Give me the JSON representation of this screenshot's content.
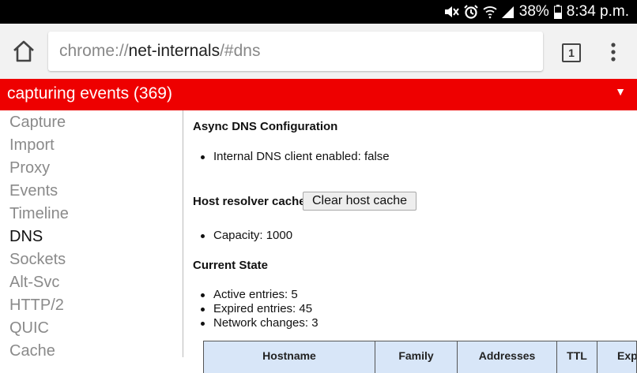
{
  "status_bar": {
    "battery_percent": "38%",
    "time": "8:34 p.m.",
    "icons": [
      "mute-icon",
      "alarm-icon",
      "wifi-icon",
      "signal-icon",
      "battery-icon"
    ]
  },
  "toolbar": {
    "url_scheme": "chrome://",
    "url_host": "net-internals",
    "url_path": "/#dns",
    "tab_count": "1",
    "icons": [
      "home-icon",
      "tab-switcher-icon",
      "overflow-menu-icon"
    ]
  },
  "banner": {
    "text": "capturing events (369)",
    "arrow": "▼",
    "color": "#ee0000"
  },
  "sidebar": {
    "items": [
      {
        "label": "Capture"
      },
      {
        "label": "Import"
      },
      {
        "label": "Proxy"
      },
      {
        "label": "Events"
      },
      {
        "label": "Timeline"
      },
      {
        "label": "DNS"
      },
      {
        "label": "Sockets"
      },
      {
        "label": "Alt-Svc"
      },
      {
        "label": "HTTP/2"
      },
      {
        "label": "QUIC"
      },
      {
        "label": "Cache"
      }
    ],
    "active": "DNS"
  },
  "main": {
    "async_title": "Async DNS Configuration",
    "internal_dns": "Internal DNS client enabled: false",
    "host_cache_title": "Host resolver cache",
    "clear_button": "Clear host cache",
    "capacity": "Capacity: 1000",
    "current_state_title": "Current State",
    "active_entries": "Active entries: 5",
    "expired_entries": "Expired entries: 45",
    "network_changes": "Network changes: 3",
    "table_headers": [
      "Hostname",
      "Family",
      "Addresses",
      "TTL",
      "Expi"
    ]
  }
}
